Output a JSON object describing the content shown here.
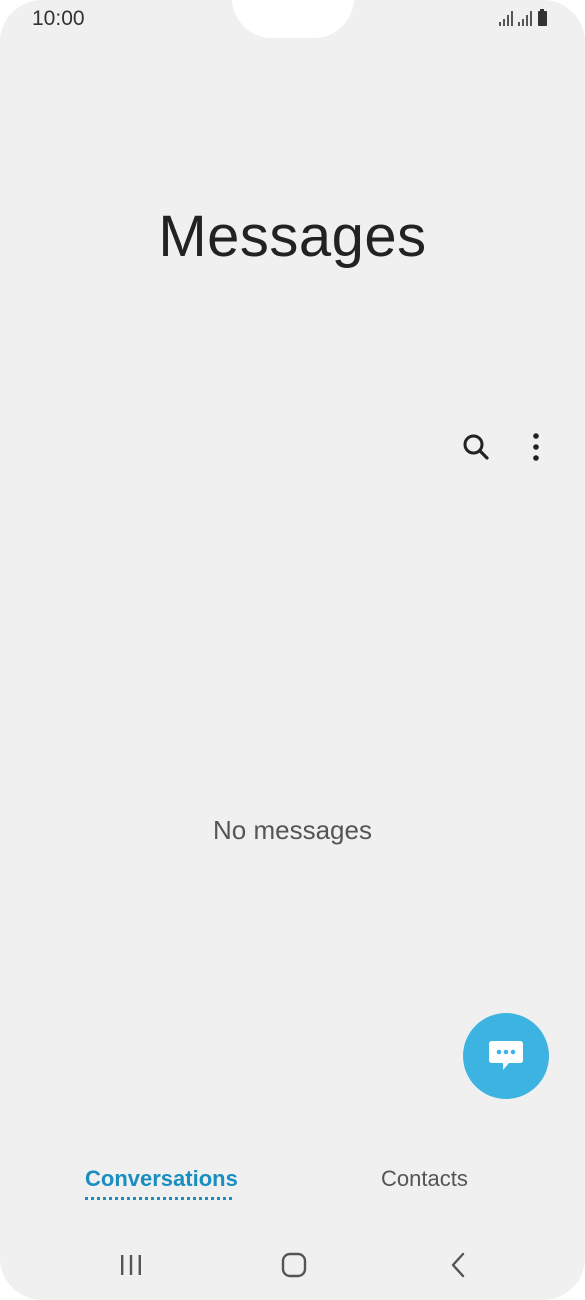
{
  "status_bar": {
    "time": "10:00",
    "icons": [
      "signal-icon",
      "signal-icon",
      "battery-icon"
    ]
  },
  "header": {
    "title": "Messages"
  },
  "toolbar": {
    "icons": [
      "search-icon",
      "more-options-icon"
    ]
  },
  "main": {
    "empty_text": "No messages"
  },
  "fab": {
    "icon": "compose-message-icon",
    "color": "#3db3e2"
  },
  "tabs": [
    {
      "label": "Conversations",
      "selected": true
    },
    {
      "label": "Contacts",
      "selected": false
    }
  ],
  "colors": {
    "accent": "#1a8ec1",
    "background": "#f0f0f0"
  },
  "nav_bar": {
    "icons": [
      "recents-icon",
      "home-icon",
      "back-icon"
    ]
  }
}
